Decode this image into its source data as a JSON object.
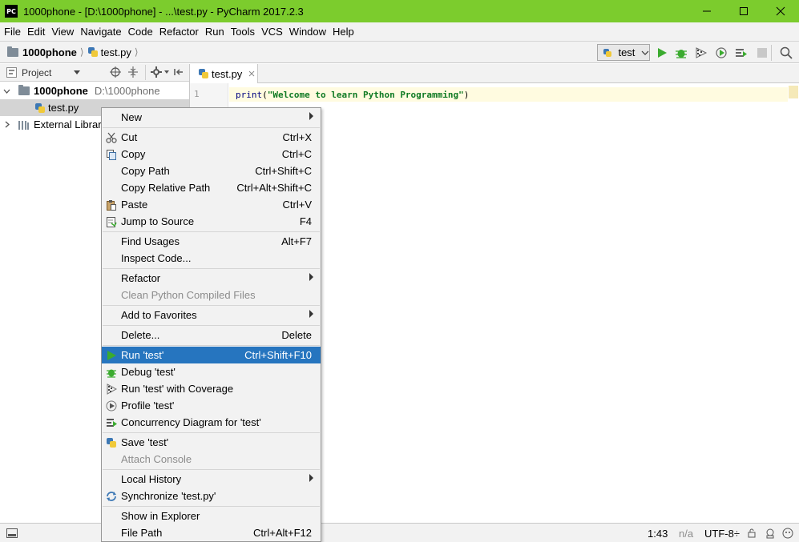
{
  "window": {
    "title": "1000phone - [D:\\1000phone] - ...\\test.py - PyCharm 2017.2.3",
    "logo": "PC",
    "title_bar_color": "#7ccc2d",
    "buttons": [
      "minimize",
      "maximize",
      "close"
    ]
  },
  "menubar": [
    "File",
    "Edit",
    "View",
    "Navigate",
    "Code",
    "Refactor",
    "Run",
    "Tools",
    "VCS",
    "Window",
    "Help"
  ],
  "navbar": {
    "project": "1000phone",
    "file": "test.py",
    "run_config": "test"
  },
  "project_panel": {
    "title": "Project",
    "root_name": "1000phone",
    "root_path": "D:\\1000phone",
    "file": "test.py",
    "external": "External Librari"
  },
  "editor": {
    "tab": "test.py",
    "line_number": "1",
    "code_fn": "print",
    "code_open": "(",
    "code_string": "\"Welcome to learn Python Programming\"",
    "code_close": ")"
  },
  "context_menu": {
    "items": [
      {
        "label": "New",
        "submenu": true
      },
      {
        "label": "Cut",
        "shortcut": "Ctrl+X",
        "icon": "scissors-icon"
      },
      {
        "label": "Copy",
        "shortcut": "Ctrl+C",
        "icon": "copy-icon"
      },
      {
        "label": "Copy Path",
        "shortcut": "Ctrl+Shift+C"
      },
      {
        "label": "Copy Relative Path",
        "shortcut": "Ctrl+Alt+Shift+C"
      },
      {
        "label": "Paste",
        "shortcut": "Ctrl+V",
        "icon": "paste-icon"
      },
      {
        "label": "Jump to Source",
        "shortcut": "F4",
        "icon": "jump-to-source-icon"
      },
      {
        "label": "Find Usages",
        "shortcut": "Alt+F7"
      },
      {
        "label": "Inspect Code..."
      },
      {
        "label": "Refactor",
        "submenu": true
      },
      {
        "label": "Clean Python Compiled Files",
        "disabled": true
      },
      {
        "label": "Add to Favorites",
        "submenu": true
      },
      {
        "label": "Delete...",
        "shortcut": "Delete"
      },
      {
        "label": "Run 'test'",
        "shortcut": "Ctrl+Shift+F10",
        "icon": "run-icon",
        "highlighted": true
      },
      {
        "label": "Debug 'test'",
        "icon": "debug-icon"
      },
      {
        "label": "Run 'test' with Coverage",
        "icon": "coverage-icon"
      },
      {
        "label": "Profile 'test'",
        "icon": "profile-icon"
      },
      {
        "label": "Concurrency Diagram for  'test'",
        "icon": "concurrency-icon"
      },
      {
        "label": "Save 'test'",
        "icon": "python-icon"
      },
      {
        "label": "Attach Console",
        "disabled": true
      },
      {
        "label": "Local History",
        "submenu": true
      },
      {
        "label": "Synchronize 'test.py'",
        "icon": "sync-icon"
      },
      {
        "label": "Show in Explorer"
      },
      {
        "label": "File Path",
        "shortcut": "Ctrl+Alt+F12"
      }
    ]
  },
  "statusbar": {
    "position": "1:43",
    "na": "n/a",
    "encoding": "UTF-8÷"
  },
  "colors": {
    "highlight": "#2675bf",
    "run_green": "#3bab2f",
    "string_green": "#0f7a24"
  }
}
